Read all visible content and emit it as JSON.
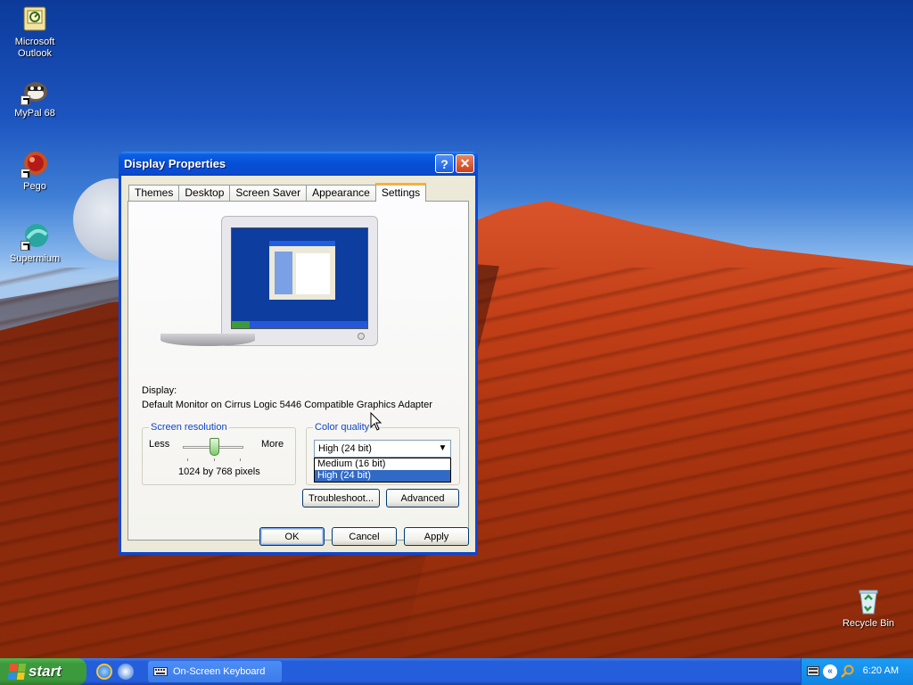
{
  "desktop": {
    "icons": [
      {
        "label": "Microsoft Outlook",
        "icon": "outlook-icon"
      },
      {
        "label": "MyPal 68",
        "icon": "mypal-icon"
      },
      {
        "label": "Pego",
        "icon": "pego-icon"
      },
      {
        "label": "Supermium",
        "icon": "supermium-icon"
      },
      {
        "label": "Recycle Bin",
        "icon": "recycle-bin-icon"
      }
    ]
  },
  "window": {
    "title": "Display Properties",
    "help_label": "?",
    "close_label": "✕",
    "tabs": [
      "Themes",
      "Desktop",
      "Screen Saver",
      "Appearance",
      "Settings"
    ],
    "active_tab": "Settings",
    "display_label": "Display:",
    "display_value": "Default Monitor on Cirrus Logic 5446 Compatible Graphics Adapter",
    "resolution": {
      "title": "Screen resolution",
      "less": "Less",
      "more": "More",
      "value": "1024 by 768 pixels"
    },
    "color_quality": {
      "title": "Color quality",
      "selected": "High (24 bit)",
      "options": [
        "Medium (16 bit)",
        "High (24 bit)"
      ],
      "highlighted": "High (24 bit)"
    },
    "buttons": {
      "troubleshoot": "Troubleshoot...",
      "advanced": "Advanced",
      "ok": "OK",
      "cancel": "Cancel",
      "apply": "Apply"
    }
  },
  "taskbar": {
    "start_label": "start",
    "task_item": "On-Screen Keyboard",
    "clock": "6:20 AM"
  },
  "colors": {
    "title_bar": "#0550d6",
    "start_button": "#3c9a3c",
    "taskbar": "#245edb",
    "selection": "#316ac5",
    "active_tab_accent": "#f5b143"
  }
}
